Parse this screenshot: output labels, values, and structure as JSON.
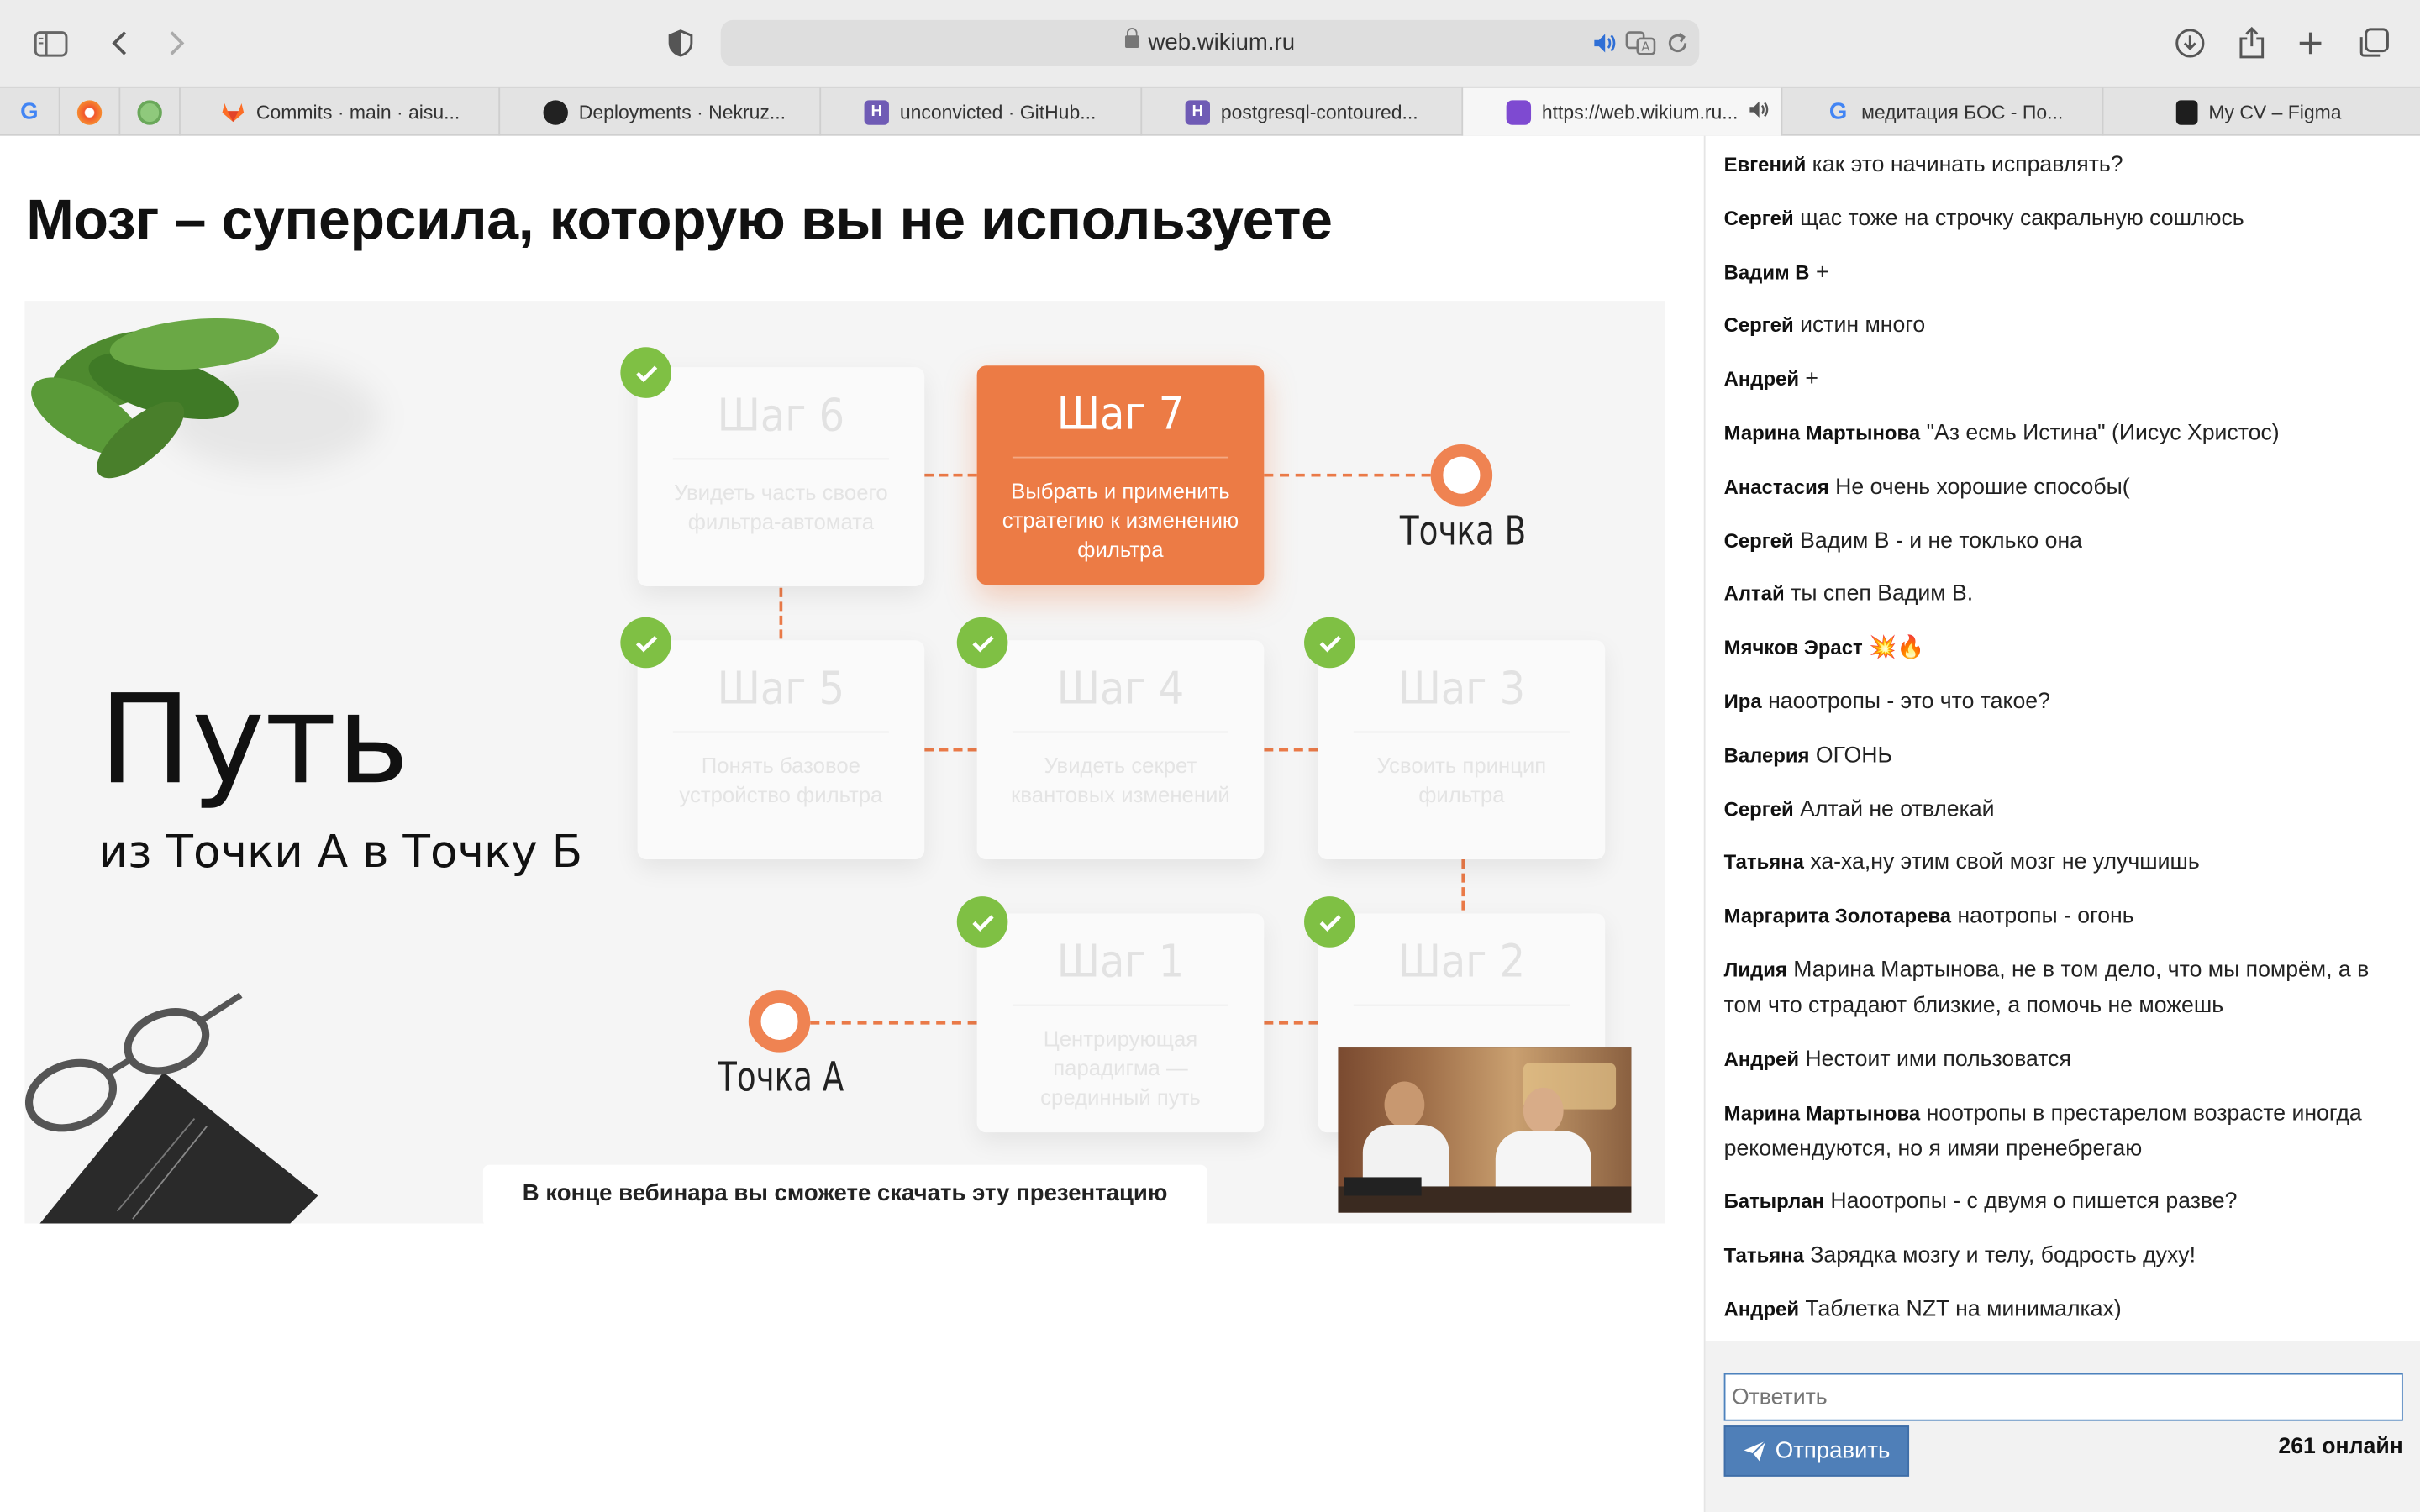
{
  "browser": {
    "url": "web.wikium.ru",
    "tabs": [
      {
        "label": "Commits · main · aisu...",
        "icon": "gitlab-icon"
      },
      {
        "label": "Deployments · Nekruz...",
        "icon": "github-icon"
      },
      {
        "label": "unconvicted · GitHub...",
        "icon": "heroku-icon"
      },
      {
        "label": "postgresql-contoured...",
        "icon": "heroku-icon"
      },
      {
        "label": "https://web.wikium.ru...",
        "icon": "wikium-icon",
        "active": true
      },
      {
        "label": "медитация БОС - По...",
        "icon": "google-icon"
      },
      {
        "label": "My CV – Figma",
        "icon": "figma-icon"
      }
    ]
  },
  "page": {
    "title": "Мозг – суперсила, которую вы не используете"
  },
  "slide": {
    "heading": "Путь",
    "subheading": "из Точки А в Точку Б",
    "point_a": "Точка А",
    "point_b": "Точка В",
    "caption": "В конце вебинара вы сможете скачать эту презентацию",
    "steps": [
      {
        "title": "Шаг 6",
        "desc": "Увидеть часть своего фильтра-автомата"
      },
      {
        "title": "Шаг 7",
        "desc": "Выбрать и применить стратегию к изменению фильтра"
      },
      {
        "title": "Шаг 5",
        "desc": "Понять базовое устройство фильтра"
      },
      {
        "title": "Шаг 4",
        "desc": "Увидеть секрет квантовых изменений"
      },
      {
        "title": "Шаг 3",
        "desc": "Усвоить принцип фильтра"
      },
      {
        "title": "Шаг 1",
        "desc": "Центрирующая парадигма — срединный путь"
      },
      {
        "title": "Шаг 2",
        "desc": ""
      }
    ]
  },
  "chat": {
    "messages": [
      {
        "author": "Евгений",
        "text": "как это начинать исправлять?"
      },
      {
        "author": "Сергей",
        "text": "щас тоже на строчку сакральную сошлюсь"
      },
      {
        "author": "Вадим В",
        "text": "+"
      },
      {
        "author": "Сергей",
        "text": "истин много"
      },
      {
        "author": "Андрей",
        "text": "+"
      },
      {
        "author": "Марина Мартынова",
        "text": "\"Аз есмь Истина\" (Иисус Христос)"
      },
      {
        "author": "Анастасия",
        "text": "Не очень хорошие способы("
      },
      {
        "author": "Сергей",
        "text": "Вадим В - и не токлько она"
      },
      {
        "author": "Алтай",
        "text": "ты спеп Вадим В."
      },
      {
        "author": "Мячков Эраст",
        "text": "💥🔥"
      },
      {
        "author": "Ира",
        "text": "наоотропы - это что такое?"
      },
      {
        "author": "Валерия",
        "text": "ОГОНЬ"
      },
      {
        "author": "Сергей",
        "text": "Алтай не отвлекай"
      },
      {
        "author": "Татьяна",
        "text": "ха-ха,ну этим свой мозг не улучшишь"
      },
      {
        "author": "Маргарита Золотарева",
        "text": "наотропы - огонь"
      },
      {
        "author": "Лидия",
        "text": "Марина Мартынова, не в том дело, что мы помрём, а в том что страдают близкие, а помочь не можешь"
      },
      {
        "author": "Андрей",
        "text": "Нестоит ими пользоватся"
      },
      {
        "author": "Марина Мартынова",
        "text": "ноотропы в престарелом возрасте иногда рекомендуются, но я имяи пренебрегаю"
      },
      {
        "author": "Батырлан",
        "text": "Наоотропы - с двумя о пишется разве?"
      },
      {
        "author": "Татьяна",
        "text": "Зарядка мозгу и телу, бодрость духу!"
      },
      {
        "author": "Андрей",
        "text": "Таблетка NZT на минималках)"
      }
    ],
    "reply_placeholder": "Ответить",
    "send_label": "Отправить",
    "online_count": "261 онлайн"
  }
}
